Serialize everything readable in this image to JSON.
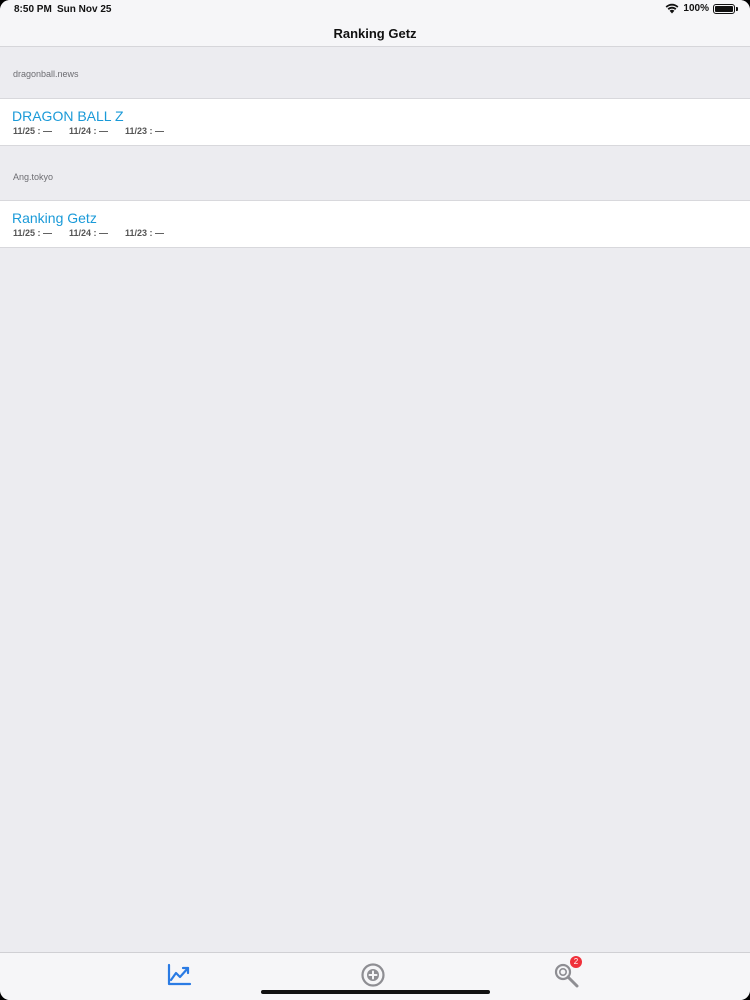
{
  "status_bar": {
    "time": "8:50 PM",
    "date": "Sun Nov 25",
    "battery": "100%"
  },
  "nav": {
    "title": "Ranking Getz"
  },
  "sections": [
    {
      "header": "dragonball.news",
      "item": {
        "title": "DRAGON BALL Z",
        "dates": [
          "11/25 : —",
          "11/24 : —",
          "11/23 : —"
        ]
      }
    },
    {
      "header": "Ang.tokyo",
      "item": {
        "title": "Ranking Getz",
        "dates": [
          "11/25 : —",
          "11/24 : —",
          "11/23 : —"
        ]
      }
    }
  ],
  "tab_bar": {
    "tabs": [
      {
        "icon": "chart-line-icon",
        "selected": true
      },
      {
        "icon": "add-circle-icon",
        "selected": false
      },
      {
        "icon": "search-icon",
        "selected": false
      }
    ],
    "search_badge": "2"
  },
  "colors": {
    "accent": "#1a9ad8",
    "tab_selected": "#2a7be4",
    "tab_unselected": "#8e8e93",
    "badge": "#f0303a",
    "background": "#ececf0"
  }
}
